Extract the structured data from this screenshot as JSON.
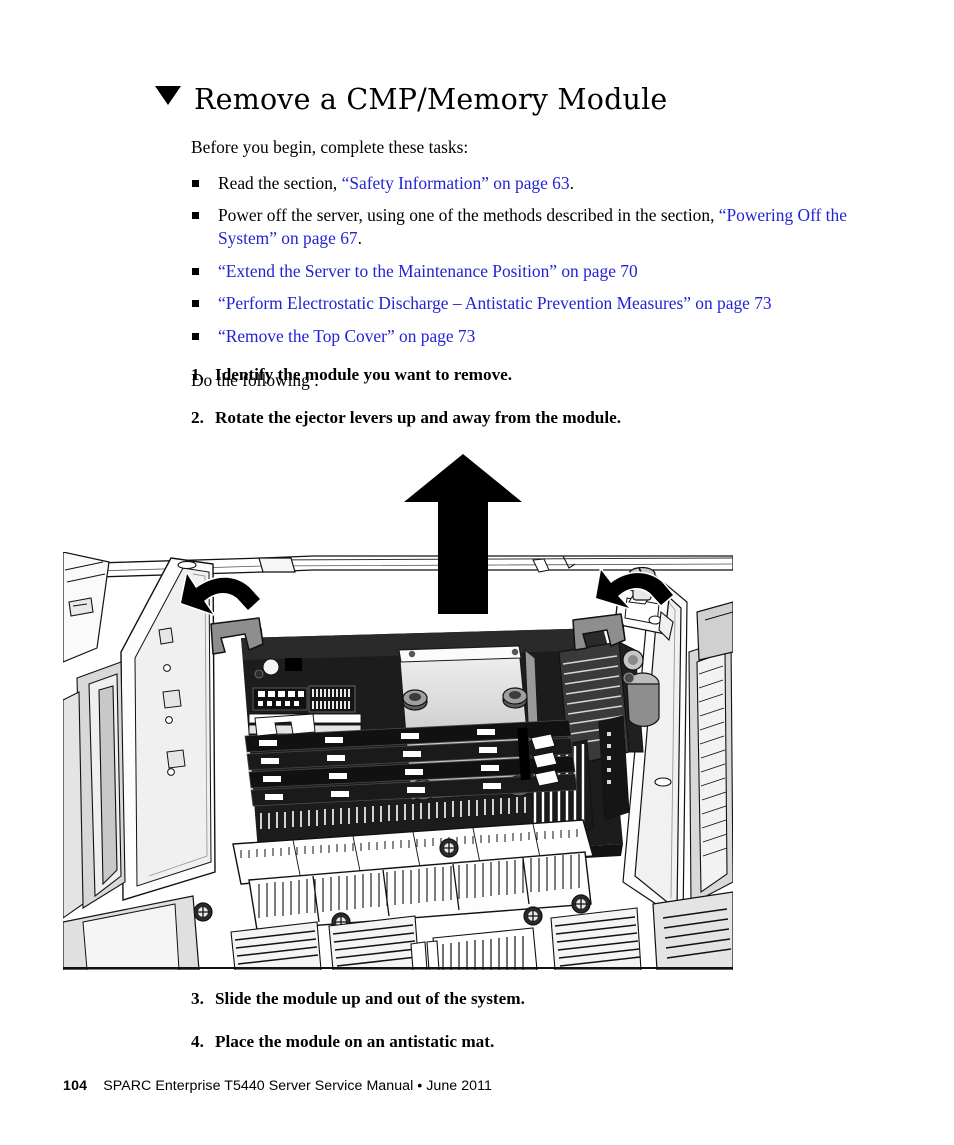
{
  "heading": {
    "marker": "triangle-down",
    "title": "Remove a CMP/Memory Module"
  },
  "intro": {
    "lead": "Before you begin, complete these tasks:",
    "do_following": "Do the following :"
  },
  "prerequisites": [
    {
      "pre": "Read the section, ",
      "link": "“Safety Information” on page 63",
      "post": "."
    },
    {
      "pre": "Power off the server, using one of the methods described in the section, ",
      "link": "“Powering Off the System” on page 67",
      "post": "."
    },
    {
      "pre": "",
      "link": "“Extend the Server to the Maintenance Position” on page 70",
      "post": ""
    },
    {
      "pre": "",
      "link": "“Perform Electrostatic Discharge – Antistatic Prevention Measures” on page 73",
      "post": ""
    },
    {
      "pre": "",
      "link": "“Remove the Top Cover” on page 73",
      "post": ""
    }
  ],
  "steps_before_figure": [
    {
      "num": "1.",
      "text": "Identify the module you want to remove."
    },
    {
      "num": "2.",
      "text": "Rotate the ejector levers up and away from the module."
    }
  ],
  "steps_after_figure": [
    {
      "num": "3.",
      "text": "Slide the module up and out of the system."
    },
    {
      "num": "4.",
      "text": "Place the module on an antistatic mat."
    }
  ],
  "figure": {
    "name": "cmp-memory-module-removal-illustration",
    "description": "Isometric line illustration of an open server chassis showing a CMP/Memory module with DIMM slots, heatsink and air baffles. A large black up arrow indicates lifting the module straight out; two curved black arrows indicate rotating the left and right ejector levers up and away.",
    "callouts": [
      {
        "name": "lift-arrow",
        "kind": "straight-up-arrow"
      },
      {
        "name": "left-ejector-lever-arrow",
        "kind": "curved-arrow"
      },
      {
        "name": "right-ejector-lever-arrow",
        "kind": "curved-arrow"
      }
    ]
  },
  "footer": {
    "page_number": "104",
    "manual_title": "SPARC Enterprise T5440 Server Service Manual  •  June 2011"
  },
  "colors": {
    "link": "#2323d6",
    "text": "#000000",
    "background": "#ffffff"
  }
}
